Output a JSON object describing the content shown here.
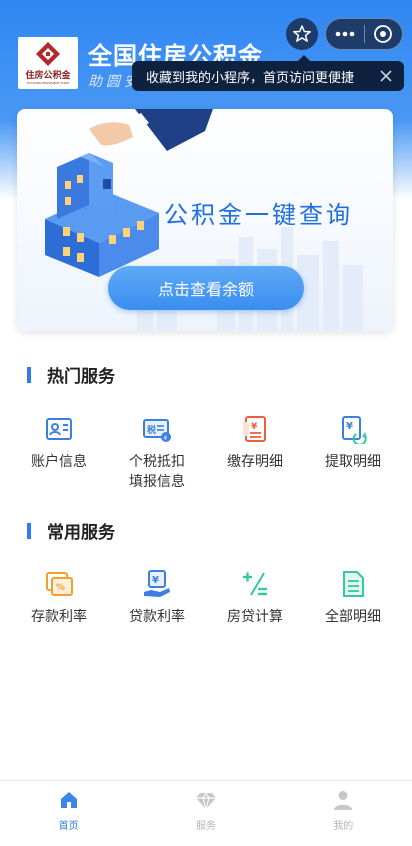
{
  "header": {
    "logo_text": "住房公积金",
    "logo_subtext": "HOUSING PROVIDENT FUND",
    "title": "全国住房公积金",
    "subtitle": "助圆安居梦"
  },
  "capsule": {
    "star_icon": "star-icon",
    "more_icon": "more-icon",
    "close_icon": "close-icon"
  },
  "tip": {
    "text": "收藏到我的小程序，首页访问更便捷",
    "close_icon": "close-icon"
  },
  "banner": {
    "title": "公积金一键查询",
    "button_label": "点击查看余额"
  },
  "hot_services": {
    "title": "热门服务",
    "items": [
      {
        "label": "账户信息",
        "icon": "id-card-icon"
      },
      {
        "label": "个税抵扣\n填报信息",
        "icon": "tax-icon"
      },
      {
        "label": "缴存明细",
        "icon": "yuan-document-icon"
      },
      {
        "label": "提取明细",
        "icon": "yuan-withdraw-icon"
      }
    ]
  },
  "common_services": {
    "title": "常用服务",
    "items": [
      {
        "label": "存款利率",
        "icon": "deposit-rate-icon"
      },
      {
        "label": "贷款利率",
        "icon": "loan-rate-icon"
      },
      {
        "label": "房贷计算",
        "icon": "calculator-icon"
      },
      {
        "label": "全部明细",
        "icon": "document-list-icon"
      }
    ]
  },
  "tabbar": {
    "items": [
      {
        "label": "首页",
        "icon": "home-icon",
        "active": true
      },
      {
        "label": "服务",
        "icon": "diamond-icon",
        "active": false
      },
      {
        "label": "我的",
        "icon": "user-icon",
        "active": false
      }
    ]
  },
  "colors": {
    "primary": "#2f7de8",
    "header_blue": "#2f86f2",
    "icon_blue": "#3c7fe0",
    "icon_orange": "#f0a030",
    "icon_teal": "#35c6a4",
    "icon_red": "#e8603c"
  }
}
